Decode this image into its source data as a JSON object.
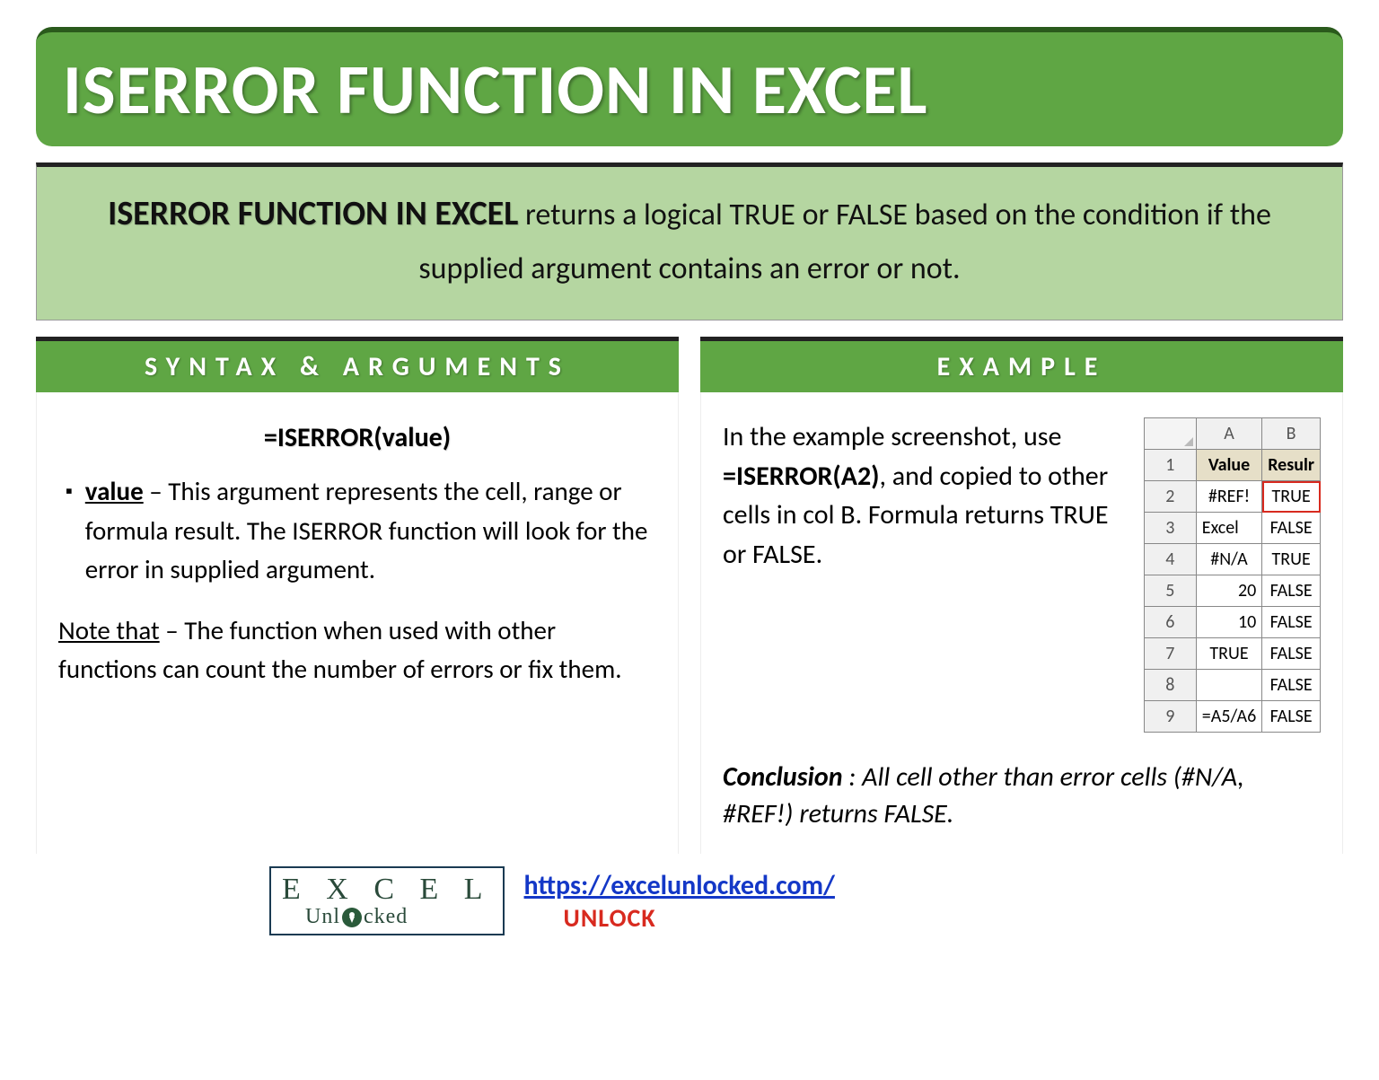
{
  "title": "ISERROR FUNCTION IN EXCEL",
  "description": {
    "lead": "ISERROR FUNCTION IN EXCEL",
    "rest": " returns a logical TRUE or FALSE based on the condition if the supplied argument contains an error or not."
  },
  "syntax": {
    "header": "SYNTAX & ARGUMENTS",
    "formula": "=ISERROR(value)",
    "arg_name": "value",
    "arg_desc": " – This argument represents the cell, range or formula result. The ISERROR function will look for the error in supplied argument.",
    "note_label": "Note that",
    "note_rest": " – The function when used with other functions can count the number of errors or fix them."
  },
  "example": {
    "header": "EXAMPLE",
    "text_pre": "In the example screenshot, use ",
    "formula": "=ISERROR(A2)",
    "text_post": ", and copied to other cells in col B. Formula returns TRUE or FALSE.",
    "conclusion_label": "Conclusion",
    "conclusion_text": " : All cell other than error cells (#N/A, #REF!) returns FALSE."
  },
  "table": {
    "colA": "A",
    "colB": "B",
    "header_value": "Value",
    "header_result": "Resulr",
    "rows": [
      {
        "n": "1"
      },
      {
        "n": "2",
        "a": "#REF!",
        "b": "TRUE",
        "align": "center",
        "hl": true
      },
      {
        "n": "3",
        "a": "Excel",
        "b": "FALSE",
        "align": "left"
      },
      {
        "n": "4",
        "a": "#N/A",
        "b": "TRUE",
        "align": "center"
      },
      {
        "n": "5",
        "a": "20",
        "b": "FALSE",
        "align": "right"
      },
      {
        "n": "6",
        "a": "10",
        "b": "FALSE",
        "align": "right"
      },
      {
        "n": "7",
        "a": "TRUE",
        "b": "FALSE",
        "align": "center"
      },
      {
        "n": "8",
        "a": "",
        "b": "FALSE",
        "align": "center"
      },
      {
        "n": "9",
        "a": "=A5/A6",
        "b": "FALSE",
        "align": "left"
      }
    ]
  },
  "footer": {
    "logo_top": "E X C   E L",
    "logo_bottom_pre": "Unl",
    "logo_bottom_post": "cked",
    "url": "https://excelunlocked.com/",
    "unlock": "UNLOCK"
  }
}
